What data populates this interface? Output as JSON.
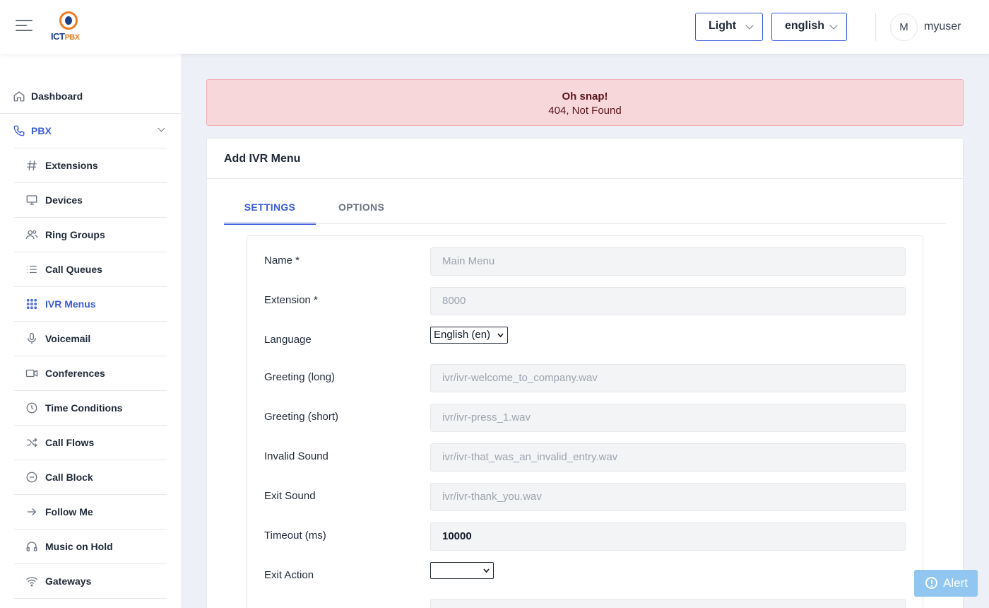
{
  "header": {
    "logo_text": "ICT",
    "logo_sub": "PBX",
    "theme": "Light",
    "language": "english",
    "avatar_initial": "M",
    "username": "myuser"
  },
  "sidebar": {
    "dashboard": "Dashboard",
    "pbx": "PBX",
    "items": [
      {
        "label": "Extensions",
        "icon": "hash-icon"
      },
      {
        "label": "Devices",
        "icon": "monitor-icon"
      },
      {
        "label": "Ring Groups",
        "icon": "users-icon"
      },
      {
        "label": "Call Queues",
        "icon": "list-icon"
      },
      {
        "label": "IVR Menus",
        "icon": "grid-icon"
      },
      {
        "label": "Voicemail",
        "icon": "microphone-icon"
      },
      {
        "label": "Conferences",
        "icon": "video-icon"
      },
      {
        "label": "Time Conditions",
        "icon": "clock-icon"
      },
      {
        "label": "Call Flows",
        "icon": "shuffle-icon"
      },
      {
        "label": "Call Block",
        "icon": "minus-circle-icon"
      },
      {
        "label": "Follow Me",
        "icon": "arrow-right-icon"
      },
      {
        "label": "Music on Hold",
        "icon": "headphones-icon"
      },
      {
        "label": "Gateways",
        "icon": "wifi-icon"
      }
    ],
    "active_color": "#3b5bdb"
  },
  "alert": {
    "title": "Oh snap!",
    "message": "404, Not Found"
  },
  "card": {
    "title": "Add IVR Menu",
    "tabs": [
      "SETTINGS",
      "OPTIONS"
    ]
  },
  "form": {
    "name_label": "Name *",
    "name_placeholder": "Main Menu",
    "extension_label": "Extension *",
    "extension_placeholder": "8000",
    "language_label": "Language",
    "language_value": "English (en)",
    "greeting_long_label": "Greeting (long)",
    "greeting_long_placeholder": "ivr/ivr-welcome_to_company.wav",
    "greeting_short_label": "Greeting (short)",
    "greeting_short_placeholder": "ivr/ivr-press_1.wav",
    "invalid_sound_label": "Invalid Sound",
    "invalid_sound_placeholder": "ivr/ivr-that_was_an_invalid_entry.wav",
    "exit_sound_label": "Exit Sound",
    "exit_sound_placeholder": "ivr/ivr-thank_you.wav",
    "timeout_label": "Timeout (ms)",
    "timeout_value": "10000",
    "exit_action_label": "Exit Action",
    "exit_action_value": ""
  },
  "alert_button": "Alert"
}
